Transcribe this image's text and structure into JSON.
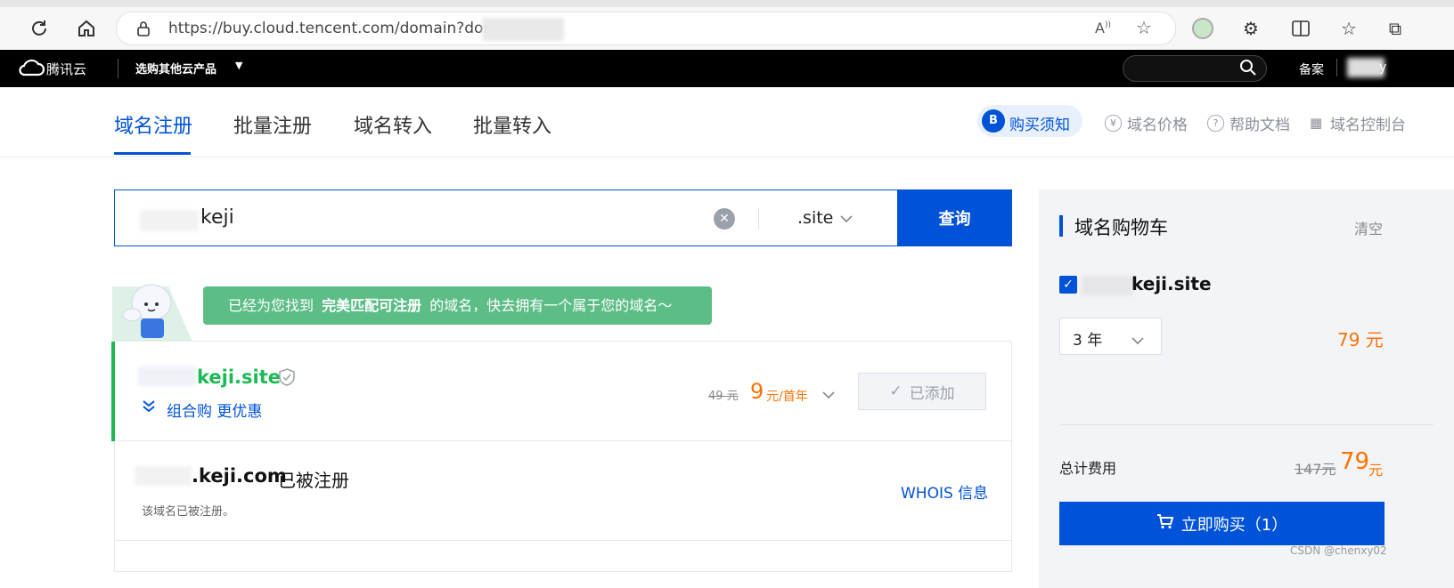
{
  "browser": {
    "url": "https://buy.cloud.tencent.com/domain?domain",
    "icons": [
      "refresh-icon",
      "home-icon",
      "lock-icon",
      "read-aloud-icon",
      "star-icon",
      "extensions-icon",
      "split-icon",
      "favorites-icon"
    ]
  },
  "topnav": {
    "brand": "腾讯云",
    "products_menu": "选购其他云产品",
    "beian": "备案",
    "user": "y"
  },
  "subnav": {
    "tabs": [
      "域名注册",
      "批量注册",
      "域名转入",
      "批量转入"
    ],
    "purchase_notice": "购买须知",
    "purchase_badge": "B",
    "price": "域名价格",
    "help": "帮助文档",
    "console": "域名控制台"
  },
  "search": {
    "value": "keji",
    "suffix": ".site",
    "button": "查询"
  },
  "banner": {
    "prefix": "已经为您找到",
    "highlight": "完美匹配可注册",
    "suffix": "的域名，快去拥有一个属于您的域名～"
  },
  "results": [
    {
      "domain_tail": "keji.site",
      "bundle": "组合购 更优惠",
      "orig_price": "49 元",
      "price": "9",
      "unit": "元/首年",
      "status_button": "已添加"
    },
    {
      "domain_tail": ".keji.com",
      "registered": "已被注册",
      "note": "该域名已被注册。",
      "whois": "WHOIS 信息"
    }
  ],
  "cart": {
    "title": "域名购物车",
    "clear": "清空",
    "item_domain": "keji.site",
    "period": "3 年",
    "item_price": "79 元",
    "total_label": "总计费用",
    "total_orig": "147元",
    "total_price": "79",
    "total_unit": "元",
    "buy_button": "立即购买（1）"
  },
  "watermark": "CSDN @chenxy02",
  "colors": {
    "accent": "#0052d9",
    "green": "#1db954",
    "orange": "#ff7200",
    "banner": "#5cbd86"
  }
}
